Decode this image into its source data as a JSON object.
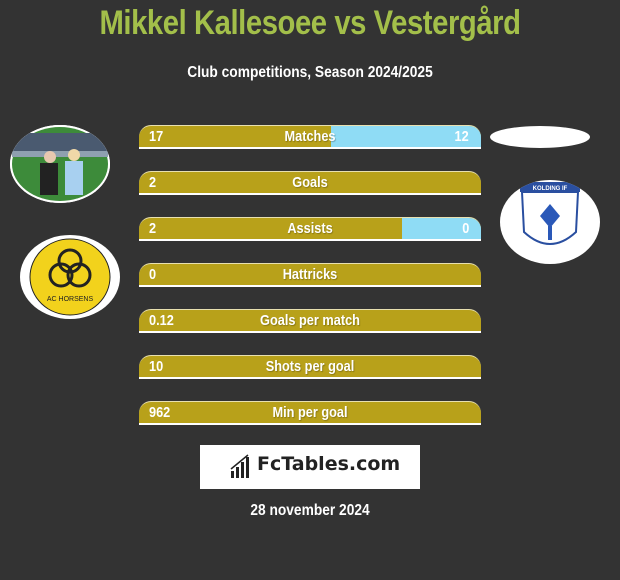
{
  "header": {
    "title": "Mikkel Kallesoee vs Vestergård",
    "subtitle": "Club competitions, Season 2024/2025"
  },
  "colors": {
    "background": "#333333",
    "title": "#a3bf4a",
    "left_bar": "#b8a11a",
    "right_bar": "#8fdcf5"
  },
  "players": {
    "left": {
      "photo": "player-photo",
      "club": "AC HORSENS"
    },
    "right": {
      "photo": "placeholder-ellipse",
      "club": "KOLDING IF"
    }
  },
  "stats": [
    {
      "label": "Matches",
      "left": "17",
      "right": "12",
      "right_share": 0.44
    },
    {
      "label": "Goals",
      "left": "2",
      "right": "",
      "right_share": 0
    },
    {
      "label": "Assists",
      "left": "2",
      "right": "0",
      "right_share": 0.23
    },
    {
      "label": "Hattricks",
      "left": "0",
      "right": "",
      "right_share": 0
    },
    {
      "label": "Goals per match",
      "left": "0.12",
      "right": "",
      "right_share": 0
    },
    {
      "label": "Shots per goal",
      "left": "10",
      "right": "",
      "right_share": 0
    },
    {
      "label": "Min per goal",
      "left": "962",
      "right": "",
      "right_share": 0
    }
  ],
  "footer": {
    "brand": "FcTables.com",
    "date": "28 november 2024"
  }
}
